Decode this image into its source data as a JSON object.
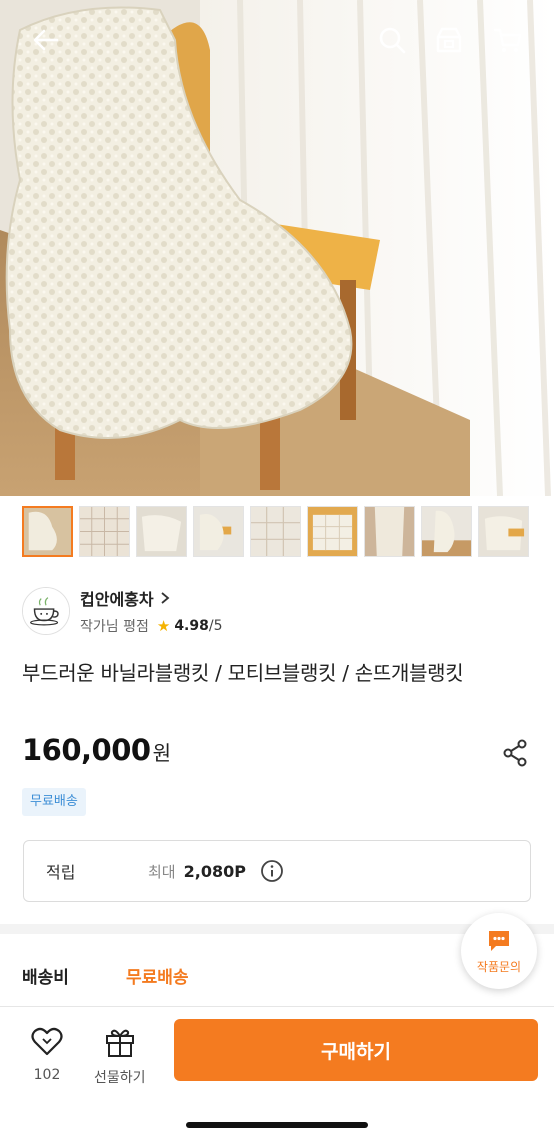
{
  "header": {
    "back_icon": "arrow-left-icon",
    "search_icon": "search-icon",
    "home_icon": "home-icon",
    "cart_icon": "cart-icon"
  },
  "gallery": {
    "thumbnail_count": 9,
    "active_index": 0
  },
  "seller": {
    "name": "컵안에홍차",
    "rating_label": "작가님 평점",
    "rating": "4.98",
    "rating_max": "/5"
  },
  "product": {
    "title": "부드러운 바닐라블랭킷 / 모티브블랭킷 / 손뜨개블랭킷",
    "price": "160,000",
    "currency": "원",
    "badge": "무료배송"
  },
  "points": {
    "label": "적립",
    "max_label": "최대",
    "value": "2,080P"
  },
  "shipping": {
    "label": "배송비",
    "value": "무료배송"
  },
  "inquiry": {
    "label": "작품문의"
  },
  "bottom_bar": {
    "like_count": "102",
    "gift_label": "선물하기",
    "buy_label": "구매하기"
  },
  "colors": {
    "accent": "#f47b20",
    "badge_bg": "#eaf3fb",
    "badge_text": "#3d8ed6"
  }
}
